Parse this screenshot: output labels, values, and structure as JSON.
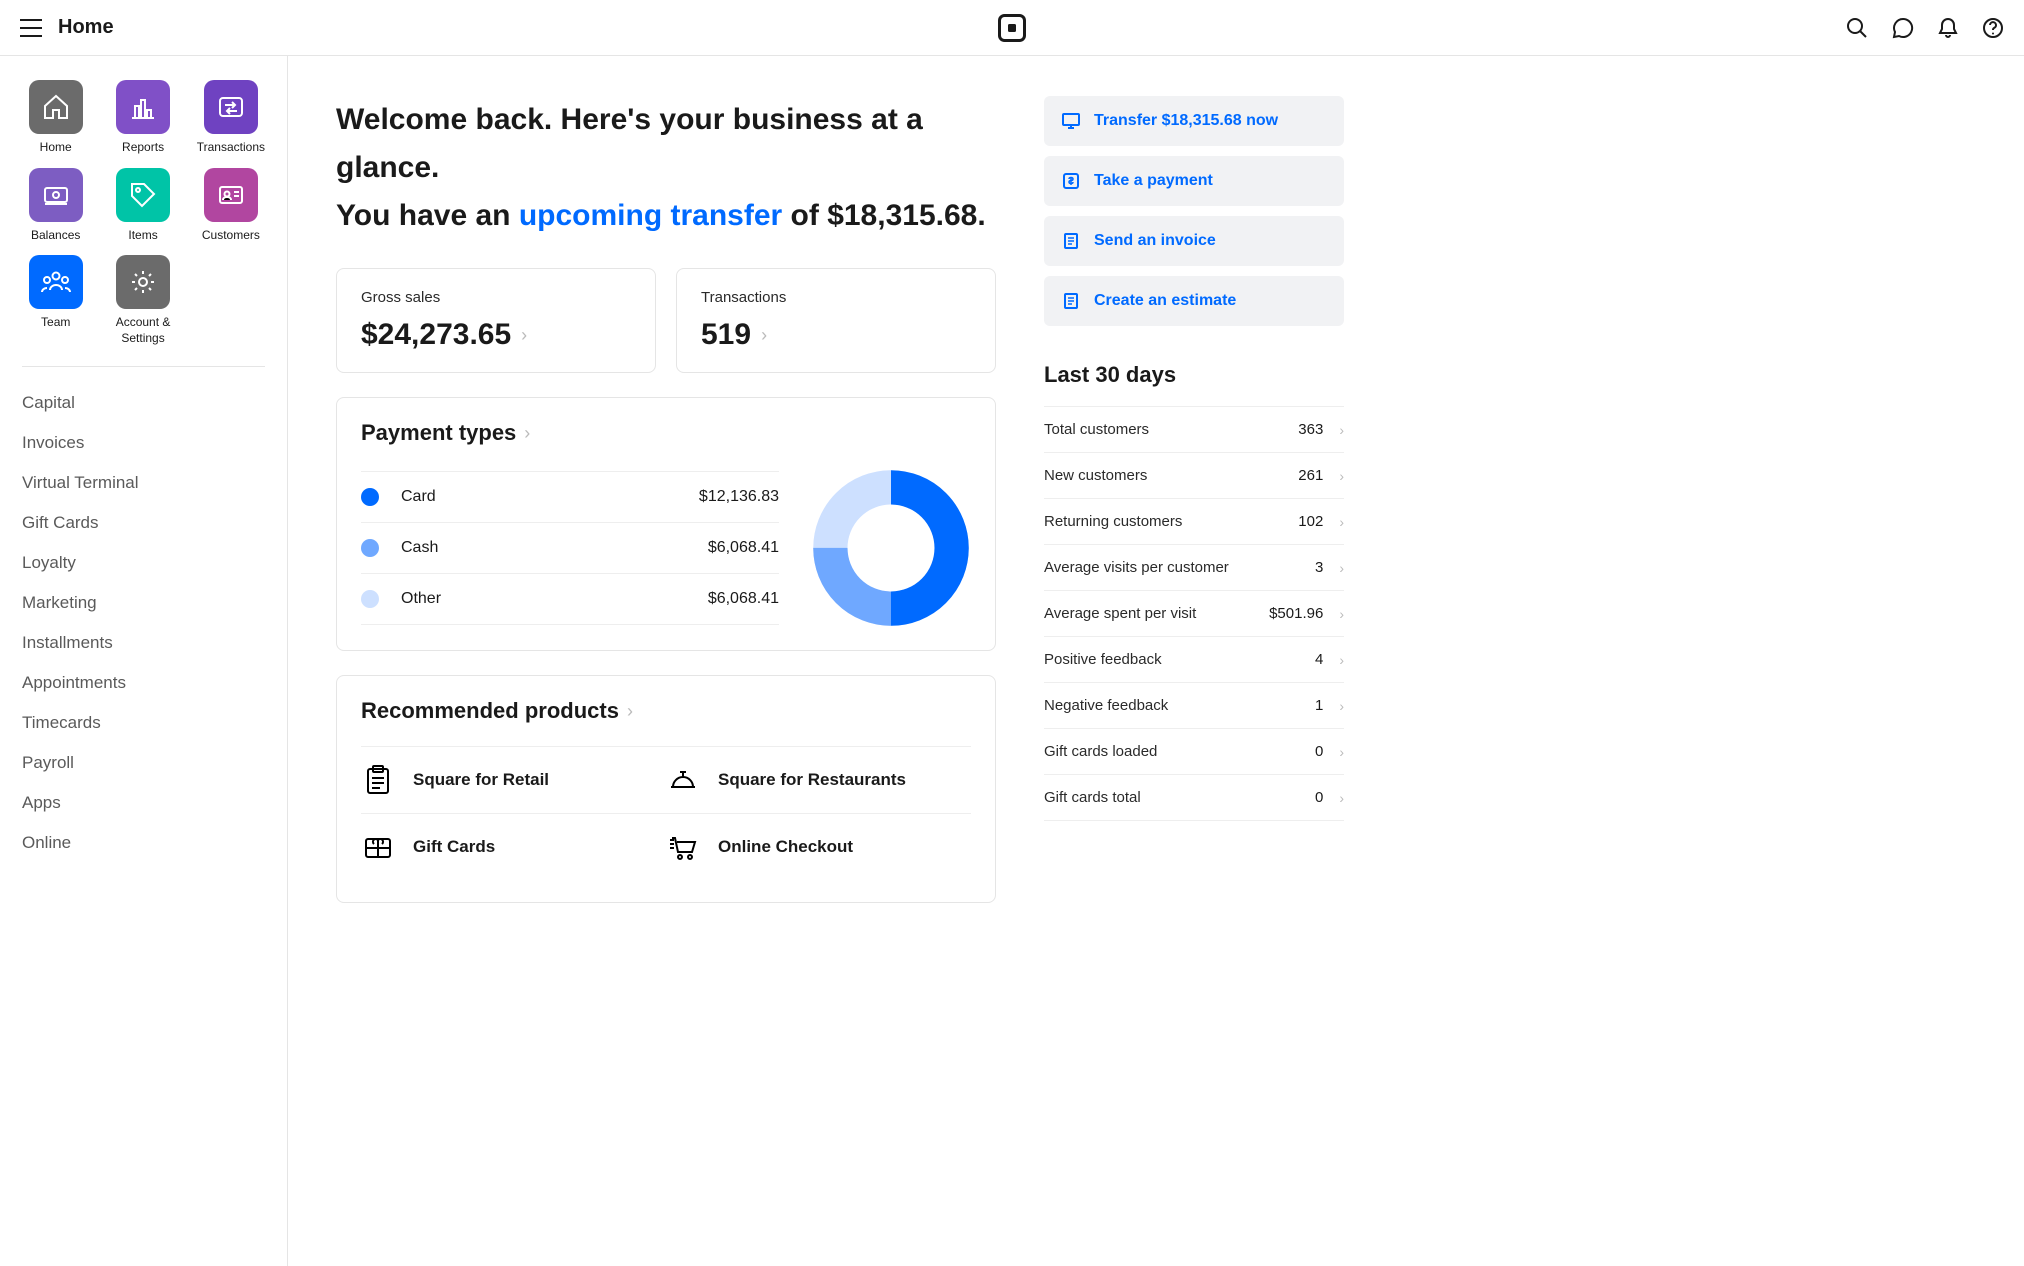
{
  "header": {
    "title": "Home"
  },
  "sidebar": {
    "tiles": [
      {
        "label": "Home"
      },
      {
        "label": "Reports"
      },
      {
        "label": "Transactions"
      },
      {
        "label": "Balances"
      },
      {
        "label": "Items"
      },
      {
        "label": "Customers"
      },
      {
        "label": "Team"
      },
      {
        "label": "Account & Settings"
      }
    ],
    "nav": [
      "Capital",
      "Invoices",
      "Virtual Terminal",
      "Gift Cards",
      "Loyalty",
      "Marketing",
      "Installments",
      "Appointments",
      "Timecards",
      "Payroll",
      "Apps",
      "Online"
    ]
  },
  "welcome": {
    "line1": "Welcome back. Here's your business at a glance.",
    "line2a": "You have an ",
    "link": "upcoming transfer",
    "line2b": " of $18,315.68."
  },
  "stats": {
    "gross_label": "Gross sales",
    "gross_value": "$24,273.65",
    "tx_label": "Transactions",
    "tx_value": "519"
  },
  "payment_types": {
    "title": "Payment types",
    "rows": [
      {
        "label": "Card",
        "value": "$12,136.83"
      },
      {
        "label": "Cash",
        "value": "$6,068.41"
      },
      {
        "label": "Other",
        "value": "$6,068.41"
      }
    ]
  },
  "recommended": {
    "title": "Recommended products",
    "items": [
      "Square for Retail",
      "Square for Restaurants",
      "Gift Cards",
      "Online Checkout"
    ]
  },
  "actions": [
    "Transfer $18,315.68 now",
    "Take a payment",
    "Send an invoice",
    "Create an estimate"
  ],
  "last30": {
    "title": "Last 30 days",
    "rows": [
      {
        "label": "Total customers",
        "value": "363"
      },
      {
        "label": "New customers",
        "value": "261"
      },
      {
        "label": "Returning customers",
        "value": "102"
      },
      {
        "label": "Average visits per customer",
        "value": "3"
      },
      {
        "label": "Average spent per visit",
        "value": "$501.96"
      },
      {
        "label": "Positive feedback",
        "value": "4"
      },
      {
        "label": "Negative feedback",
        "value": "1"
      },
      {
        "label": "Gift cards loaded",
        "value": "0"
      },
      {
        "label": "Gift cards total",
        "value": "0"
      }
    ]
  },
  "chart_data": {
    "type": "pie",
    "title": "Payment types",
    "series": [
      {
        "name": "Card",
        "value": 12136.83
      },
      {
        "name": "Cash",
        "value": 6068.41
      },
      {
        "name": "Other",
        "value": 6068.41
      }
    ]
  }
}
